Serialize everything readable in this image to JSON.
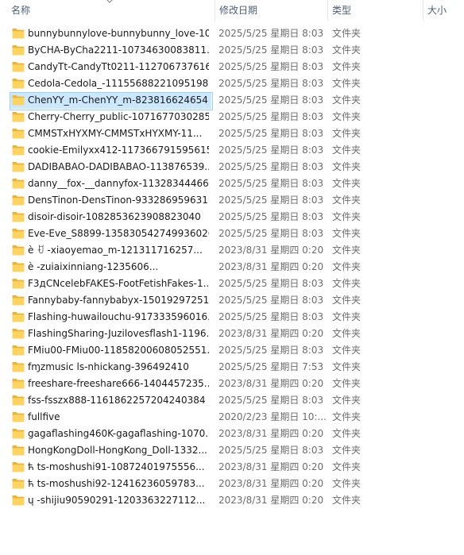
{
  "header": {
    "col_name": "名称",
    "col_date": "修改日期",
    "col_type": "类型",
    "col_size": "大小"
  },
  "colors": {
    "selected_bg": "#cce8ff",
    "selected_border": "#99d1ff",
    "folder_yellow": "#ffd45e"
  },
  "selected_index": 4,
  "files": [
    {
      "name": "bunnybunnylove-bunnybunny_love-10...",
      "date": "2025/5/25 星期日 8:03",
      "type": "文件夹"
    },
    {
      "name": "ByCHA-ByCha2211-10734630083811...",
      "date": "2025/5/25 星期日 8:03",
      "type": "文件夹"
    },
    {
      "name": "CandyTt-CandyTt0211-112706737616...",
      "date": "2025/5/25 星期日 8:03",
      "type": "文件夹"
    },
    {
      "name": "Cedola-Cedola_-11155688221095198...",
      "date": "2025/5/25 星期日 8:03",
      "type": "文件夹"
    },
    {
      "name": "ChenYY_m-ChenYY_m-823816624654...",
      "date": "2025/5/25 星期日 8:03",
      "type": "文件夹"
    },
    {
      "name": "Cherry-Cherry_public-1071677030285...",
      "date": "2025/5/25 星期日 8:03",
      "type": "文件夹"
    },
    {
      "name": "CMMSTxHYXMY-CMMSTxHYXMY-11...",
      "date": "2025/5/25 星期日 8:03",
      "type": "文件夹"
    },
    {
      "name": "cookie-Emilyxx412-117366791595615...",
      "date": "2025/5/25 星期日 8:03",
      "type": "文件夹"
    },
    {
      "name": "DADIBABAO-DADIBABAO-113876539...",
      "date": "2025/5/25 星期日 8:03",
      "type": "文件夹"
    },
    {
      "name": "danny__fox-__dannyfox-11328344466...",
      "date": "2025/5/25 星期日 8:03",
      "type": "文件夹"
    },
    {
      "name": "DensTinon-DensTinon-933286959631...",
      "date": "2025/5/25 星期日 8:03",
      "type": "文件夹"
    },
    {
      "name": "disoir-disoir-1082853623908823040",
      "date": "2025/5/25 星期日 8:03",
      "type": "文件夹"
    },
    {
      "name": "Eve-Eve_S8899-1358305427499360261",
      "date": "2025/5/25 星期日 8:03",
      "type": "文件夹"
    },
    {
      "name": "è   ꀀ   -xiaoyemao_m-121311716257...",
      "date": "2023/8/31 星期四 0:20",
      "type": "文件夹"
    },
    {
      "name": "è              -zuiaixinniang-1235606...",
      "date": "2023/8/31 星期四 0:20",
      "type": "文件夹"
    },
    {
      "name": "F3дCNcelebFAKES-FootFetishFakes-1...",
      "date": "2025/5/25 星期日 8:03",
      "type": "文件夹"
    },
    {
      "name": "Fannybaby-fannybabyx-15019297251...",
      "date": "2025/5/25 星期日 8:03",
      "type": "文件夹"
    },
    {
      "name": "Flashing-huwailouchu-917333596016...",
      "date": "2025/5/25 星期日 8:03",
      "type": "文件夹"
    },
    {
      "name": "FlashingSharing-Juzilovesflash1-1196...",
      "date": "2023/8/31 星期四 0:20",
      "type": "文件夹"
    },
    {
      "name": "FMiu00-FMiu00-11858200608052551...",
      "date": "2025/5/25 星期日 8:03",
      "type": "文件夹"
    },
    {
      "name": "fɱzmusic       ls-nhickang-396492410",
      "date": "2025/5/25 星期日 7:53",
      "type": "文件夹"
    },
    {
      "name": "freeshare-freeshare666-1404457235...",
      "date": "2023/8/31 星期四 0:20",
      "type": "文件夹"
    },
    {
      "name": "fss-fsszx888-1161862257204240384",
      "date": "2025/5/25 星期日 8:03",
      "type": "文件夹"
    },
    {
      "name": "fullfive",
      "date": "2020/2/23 星期日 10:...",
      "type": "文件夹"
    },
    {
      "name": "gagaflashing460K-gagaflashing-1070...",
      "date": "2023/8/31 星期四 0:20",
      "type": "文件夹"
    },
    {
      "name": "HongKongDoll-HongKong_Doll-1332...",
      "date": "2025/5/25 星期日 8:03",
      "type": "文件夹"
    },
    {
      "name": "ћ       ts-moshushi91-10872401975556...",
      "date": "2023/8/31 星期四 0:20",
      "type": "文件夹"
    },
    {
      "name": "ћ       ts-moshushi92-12416236059783...",
      "date": "2023/8/31 星期四 0:20",
      "type": "文件夹"
    },
    {
      "name": "ų        -shijiu90590291-1203363227112...",
      "date": "2023/8/31 星期四 0:20",
      "type": "文件夹"
    }
  ]
}
